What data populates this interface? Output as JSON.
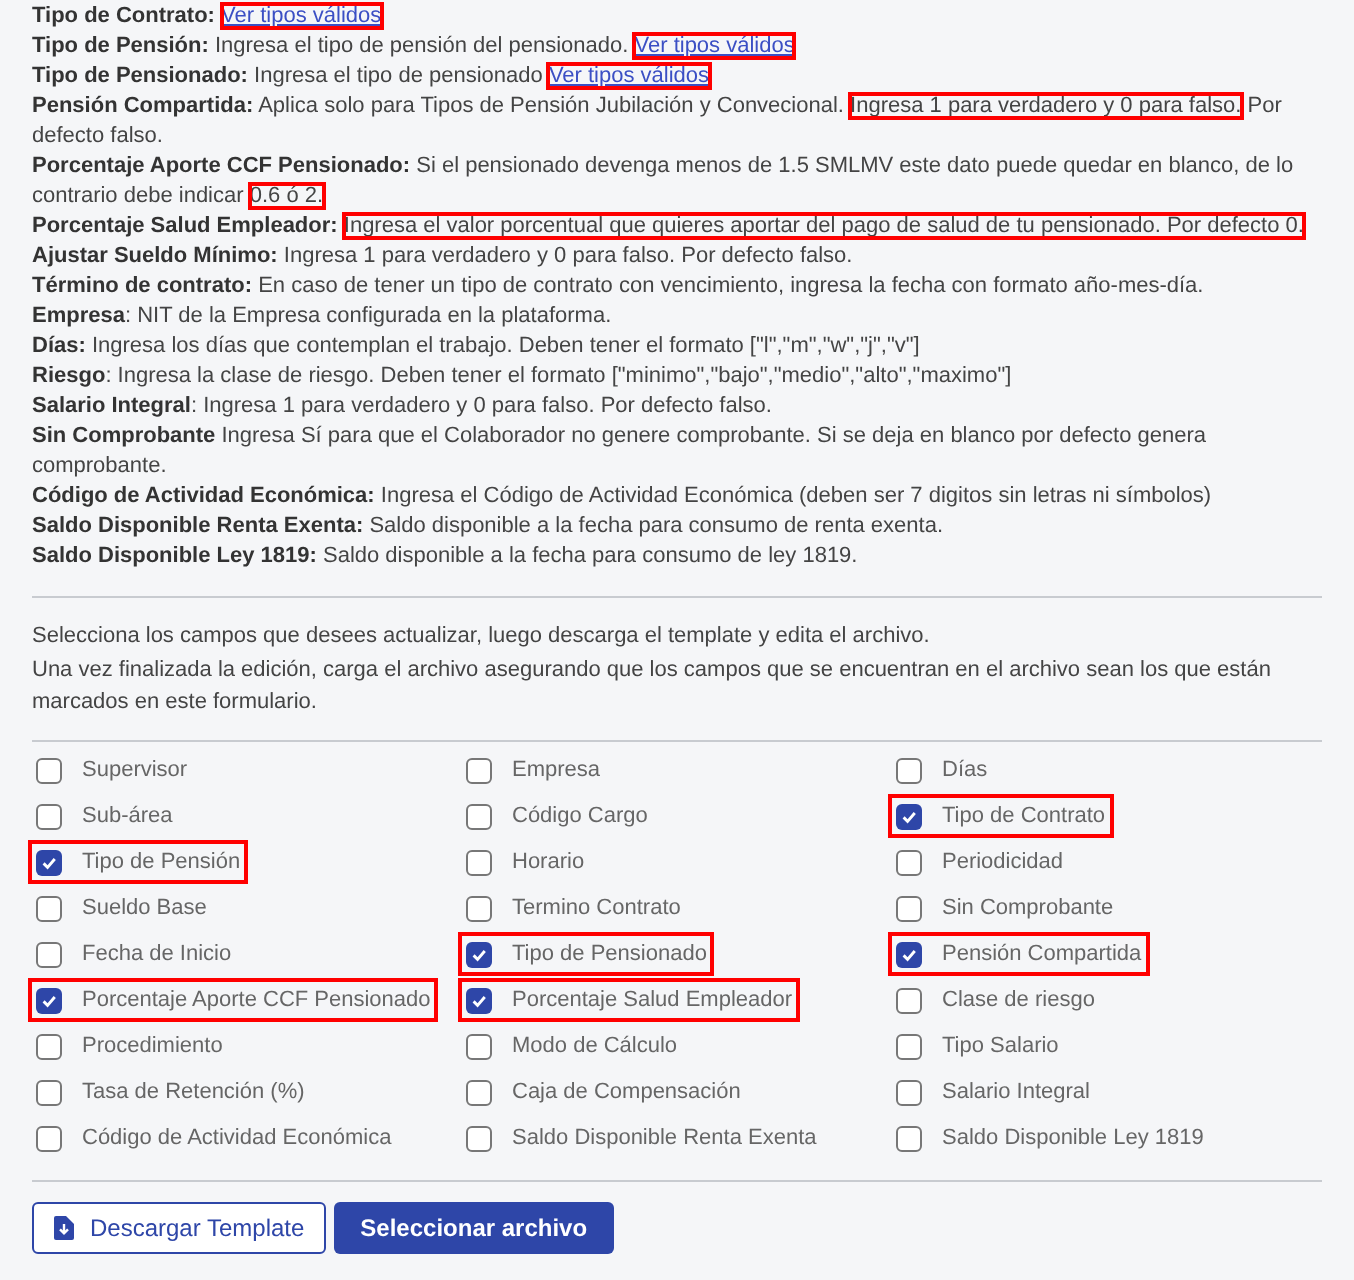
{
  "descriptions": [
    {
      "segments": [
        {
          "kind": "text",
          "text": "**Tipo de Contrato:** ",
          "highlighted": false
        },
        {
          "kind": "link",
          "text": "Ver tipos válidos",
          "highlighted": true
        }
      ]
    },
    {
      "segments": [
        {
          "kind": "text",
          "text": "**Tipo de Pensión:** Ingresa el tipo de pensión del pensionado. ",
          "highlighted": false
        },
        {
          "kind": "link",
          "text": "Ver tipos válidos",
          "highlighted": true
        }
      ]
    },
    {
      "segments": [
        {
          "kind": "text",
          "text": "**Tipo de Pensionado:** Ingresa el tipo de pensionado ",
          "highlighted": false
        },
        {
          "kind": "link",
          "text": "Ver tipos válidos",
          "highlighted": true
        }
      ]
    },
    {
      "segments": [
        {
          "kind": "text",
          "text": "**Pensión Compartida:** Aplica solo para Tipos de Pensión Jubilación y Convecional. ",
          "highlighted": false
        },
        {
          "kind": "text",
          "text": "Ingresa 1 para verdadero y 0 para falso.",
          "highlighted": true
        },
        {
          "kind": "text",
          "text": " Por defecto falso.",
          "highlighted": false
        }
      ]
    },
    {
      "segments": [
        {
          "kind": "text",
          "text": "**Porcentaje Aporte CCF Pensionado:** Si el pensionado devenga menos de 1.5 SMLMV este dato puede quedar en blanco, de lo contrario debe indicar ",
          "highlighted": false
        },
        {
          "kind": "text",
          "text": "0.6 ó 2.",
          "highlighted": true
        }
      ]
    },
    {
      "segments": [
        {
          "kind": "text",
          "text": "**Porcentaje Salud Empleador:** ",
          "highlighted": false
        },
        {
          "kind": "text",
          "text": "Ingresa el valor porcentual que quieres aportar del pago de salud de tu pensionado. Por defecto 0.",
          "highlighted": true
        }
      ]
    },
    {
      "segments": [
        {
          "kind": "text",
          "text": "**Ajustar Sueldo Mínimo:** Ingresa 1 para verdadero y 0 para falso. Por defecto falso.",
          "highlighted": false
        }
      ]
    },
    {
      "segments": [
        {
          "kind": "text",
          "text": "**Término de contrato:** En caso de tener un tipo de contrato con vencimiento, ingresa la fecha con formato año-mes-día.",
          "highlighted": false
        }
      ]
    },
    {
      "segments": [
        {
          "kind": "text",
          "text": "**Empresa**: NIT de la Empresa configurada en la plataforma.",
          "highlighted": false
        }
      ]
    },
    {
      "segments": [
        {
          "kind": "text",
          "text": "**Días:** Ingresa los días que contemplan el trabajo. Deben tener el formato [\"l\",\"m\",\"w\",\"j\",\"v\"]",
          "highlighted": false
        }
      ]
    },
    {
      "segments": [
        {
          "kind": "text",
          "text": "**Riesgo**: Ingresa la clase de riesgo. Deben tener el formato [\"minimo\",\"bajo\",\"medio\",\"alto\",\"maximo\"]",
          "highlighted": false
        }
      ]
    },
    {
      "segments": [
        {
          "kind": "text",
          "text": "**Salario Integral**: Ingresa 1 para verdadero y 0 para falso. Por defecto falso.",
          "highlighted": false
        }
      ]
    },
    {
      "segments": [
        {
          "kind": "text",
          "text": "**Sin Comprobante** Ingresa Sí para que el Colaborador no genere comprobante. Si se deja en blanco por defecto genera comprobante.",
          "highlighted": false
        }
      ]
    },
    {
      "segments": [
        {
          "kind": "text",
          "text": "**Código de Actividad Económica:** Ingresa el Código de Actividad Económica (deben ser 7 digitos sin letras ni símbolos)",
          "highlighted": false
        }
      ]
    },
    {
      "segments": [
        {
          "kind": "text",
          "text": "**Saldo Disponible Renta Exenta:** Saldo disponible a la fecha para consumo de renta exenta.",
          "highlighted": false
        }
      ]
    },
    {
      "segments": [
        {
          "kind": "text",
          "text": "**Saldo Disponible Ley 1819:** Saldo disponible a la fecha para consumo de ley 1819.",
          "highlighted": false
        }
      ]
    }
  ],
  "instructions": [
    "Selecciona los campos que desees actualizar, luego descarga el template y edita el archivo.",
    "Una vez finalizada la edición, carga el archivo asegurando que los campos que se encuentran en el archivo sean los que están marcados en este formulario."
  ],
  "fields": [
    {
      "label": "Supervisor",
      "checked": false,
      "highlighted": false
    },
    {
      "label": "Empresa",
      "checked": false,
      "highlighted": false
    },
    {
      "label": "Días",
      "checked": false,
      "highlighted": false
    },
    {
      "label": "Sub-área",
      "checked": false,
      "highlighted": false
    },
    {
      "label": "Código Cargo",
      "checked": false,
      "highlighted": false
    },
    {
      "label": "Tipo de Contrato",
      "checked": true,
      "highlighted": true
    },
    {
      "label": "Tipo de Pensión",
      "checked": true,
      "highlighted": true
    },
    {
      "label": "Horario",
      "checked": false,
      "highlighted": false
    },
    {
      "label": "Periodicidad",
      "checked": false,
      "highlighted": false
    },
    {
      "label": "Sueldo Base",
      "checked": false,
      "highlighted": false
    },
    {
      "label": "Termino Contrato",
      "checked": false,
      "highlighted": false
    },
    {
      "label": "Sin Comprobante",
      "checked": false,
      "highlighted": false
    },
    {
      "label": "Fecha de Inicio",
      "checked": false,
      "highlighted": false
    },
    {
      "label": "Tipo de Pensionado",
      "checked": true,
      "highlighted": true
    },
    {
      "label": "Pensión Compartida",
      "checked": true,
      "highlighted": true
    },
    {
      "label": "Porcentaje Aporte CCF Pensionado",
      "checked": true,
      "highlighted": true
    },
    {
      "label": "Porcentaje Salud Empleador",
      "checked": true,
      "highlighted": true
    },
    {
      "label": "Clase de riesgo",
      "checked": false,
      "highlighted": false
    },
    {
      "label": "Procedimiento",
      "checked": false,
      "highlighted": false
    },
    {
      "label": "Modo de Cálculo",
      "checked": false,
      "highlighted": false
    },
    {
      "label": "Tipo Salario",
      "checked": false,
      "highlighted": false
    },
    {
      "label": "Tasa de Retención (%)",
      "checked": false,
      "highlighted": false
    },
    {
      "label": "Caja de Compensación",
      "checked": false,
      "highlighted": false
    },
    {
      "label": "Salario Integral",
      "checked": false,
      "highlighted": false
    },
    {
      "label": "Código de Actividad Económica",
      "checked": false,
      "highlighted": false
    },
    {
      "label": "Saldo Disponible Renta Exenta",
      "checked": false,
      "highlighted": false
    },
    {
      "label": "Saldo Disponible Ley 1819",
      "checked": false,
      "highlighted": false
    }
  ],
  "buttons": [
    {
      "kind": "download",
      "label": "Descargar Template"
    },
    {
      "kind": "primary",
      "label": "Seleccionar archivo"
    }
  ]
}
